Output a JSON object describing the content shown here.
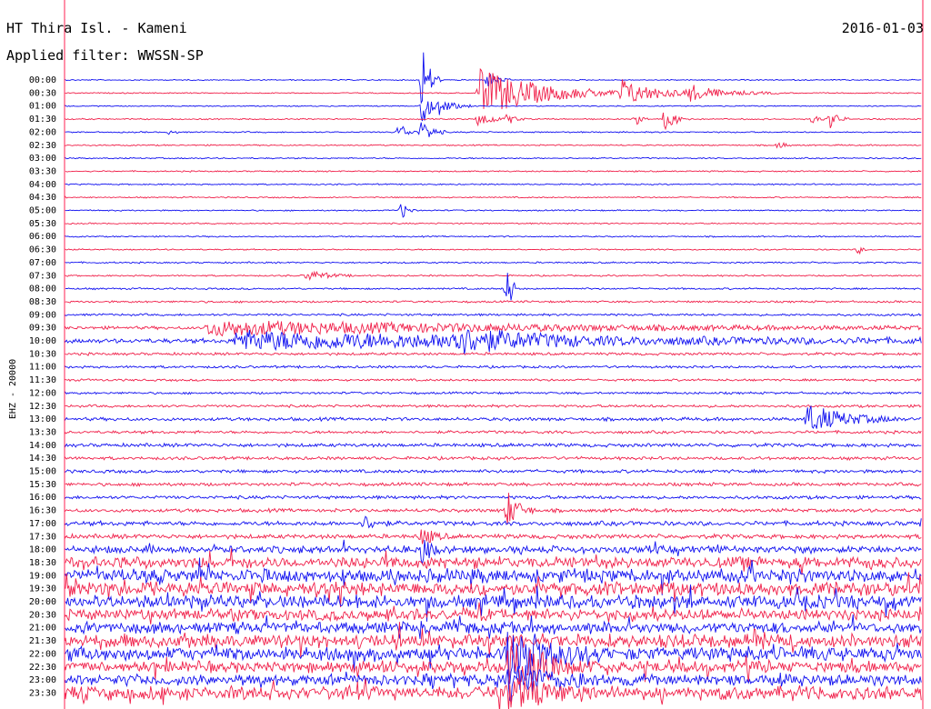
{
  "header": {
    "station": "HT Thira Isl. - Kameni",
    "filter": "Applied filter: WWSSN-SP",
    "date": "2016-01-03"
  },
  "colors": {
    "trace_a": "#1010f0",
    "trace_b": "#f0204a",
    "frame": "#ff2050",
    "text": "#000000"
  },
  "chart_data": {
    "type": "line",
    "title": "HT Thira Isl. - Kameni",
    "subtitle": "Applied filter: WWSSN-SP",
    "ylabel": "EHZ - 20000",
    "rows": [
      "00:00",
      "00:30",
      "01:00",
      "01:30",
      "02:00",
      "02:30",
      "03:00",
      "03:30",
      "04:00",
      "04:30",
      "05:00",
      "05:30",
      "06:00",
      "06:30",
      "07:00",
      "07:30",
      "08:00",
      "08:30",
      "09:00",
      "09:30",
      "10:00",
      "10:30",
      "11:00",
      "11:30",
      "12:00",
      "12:30",
      "13:00",
      "13:30",
      "14:00",
      "14:30",
      "15:00",
      "15:30",
      "16:00",
      "16:30",
      "17:00",
      "17:30",
      "18:00",
      "18:30",
      "19:00",
      "19:30",
      "20:00",
      "20:30",
      "21:00",
      "21:30",
      "22:00",
      "22:30",
      "23:00",
      "23:30"
    ],
    "x_range_minutes": [
      0,
      30
    ],
    "row_colors_alternate": [
      "blue",
      "red"
    ],
    "noise_level": [
      0.5,
      0.5,
      0.5,
      0.6,
      0.6,
      0.6,
      0.6,
      0.6,
      0.6,
      0.6,
      0.6,
      0.6,
      0.6,
      0.6,
      0.7,
      0.7,
      0.8,
      0.9,
      1,
      1.4,
      2,
      1.2,
      1.1,
      1,
      1,
      1.2,
      1.5,
      1.3,
      1.6,
      1.4,
      1.5,
      1.5,
      1.5,
      1.6,
      2,
      2,
      3.2,
      5,
      6,
      6,
      6,
      5,
      5,
      6,
      6,
      5,
      5,
      6
    ],
    "events": [
      {
        "row": "00:00",
        "minute": 12.5,
        "amp": 40,
        "dur": 0.4
      },
      {
        "row": "00:00",
        "minute": 14.8,
        "amp": 9,
        "dur": 0.5
      },
      {
        "row": "00:30",
        "minute": 14.5,
        "amp": 28,
        "dur": 3.2
      },
      {
        "row": "00:30",
        "minute": 19.5,
        "amp": 14,
        "dur": 2
      },
      {
        "row": "00:30",
        "minute": 21.8,
        "amp": 8,
        "dur": 2
      },
      {
        "row": "01:00",
        "minute": 12.5,
        "amp": 22,
        "dur": 0.4
      },
      {
        "row": "01:00",
        "minute": 13,
        "amp": 10,
        "dur": 0.8
      },
      {
        "row": "01:30",
        "minute": 14.5,
        "amp": 10,
        "dur": 0.6
      },
      {
        "row": "01:30",
        "minute": 15.5,
        "amp": 6,
        "dur": 0.4
      },
      {
        "row": "01:30",
        "minute": 20,
        "amp": 6,
        "dur": 0.3
      },
      {
        "row": "01:30",
        "minute": 21,
        "amp": 12,
        "dur": 0.6
      },
      {
        "row": "01:30",
        "minute": 26.2,
        "amp": 5,
        "dur": 0.3
      },
      {
        "row": "01:30",
        "minute": 26.8,
        "amp": 10,
        "dur": 0.4
      },
      {
        "row": "02:00",
        "minute": 12.5,
        "amp": 14,
        "dur": 0.5
      },
      {
        "row": "02:00",
        "minute": 11.7,
        "amp": 10,
        "dur": 0.4
      },
      {
        "row": "02:00",
        "minute": 3.7,
        "amp": 4,
        "dur": 0.2
      },
      {
        "row": "02:30",
        "minute": 25,
        "amp": 5,
        "dur": 0.3
      },
      {
        "row": "05:00",
        "minute": 11.8,
        "amp": 10,
        "dur": 0.3
      },
      {
        "row": "06:30",
        "minute": 27.8,
        "amp": 5,
        "dur": 0.2
      },
      {
        "row": "07:30",
        "minute": 8.5,
        "amp": 6,
        "dur": 1
      },
      {
        "row": "08:00",
        "minute": 15.5,
        "amp": 35,
        "dur": 0.2
      },
      {
        "row": "09:30",
        "minute": 5,
        "amp": 8,
        "dur": 16
      },
      {
        "row": "10:00",
        "minute": 6,
        "amp": 10,
        "dur": 18
      },
      {
        "row": "10:00",
        "minute": 13.5,
        "amp": 12,
        "dur": 3
      },
      {
        "row": "13:00",
        "minute": 26,
        "amp": 16,
        "dur": 2
      },
      {
        "row": "16:30",
        "minute": 15.5,
        "amp": 20,
        "dur": 0.6
      },
      {
        "row": "17:00",
        "minute": 10.5,
        "amp": 8,
        "dur": 0.6
      },
      {
        "row": "17:00",
        "minute": 30,
        "amp": 12,
        "dur": 0.6
      },
      {
        "row": "17:30",
        "minute": 12.5,
        "amp": 10,
        "dur": 0.6
      },
      {
        "row": "18:00",
        "minute": 12.5,
        "amp": 14,
        "dur": 0.5
      },
      {
        "row": "22:00",
        "minute": 15.5,
        "amp": 30,
        "dur": 2
      },
      {
        "row": "22:30",
        "minute": 15.5,
        "amp": 28,
        "dur": 2
      },
      {
        "row": "23:00",
        "minute": 15.5,
        "amp": 22,
        "dur": 2
      },
      {
        "row": "23:30",
        "minute": 15.5,
        "amp": 16,
        "dur": 2
      }
    ]
  }
}
